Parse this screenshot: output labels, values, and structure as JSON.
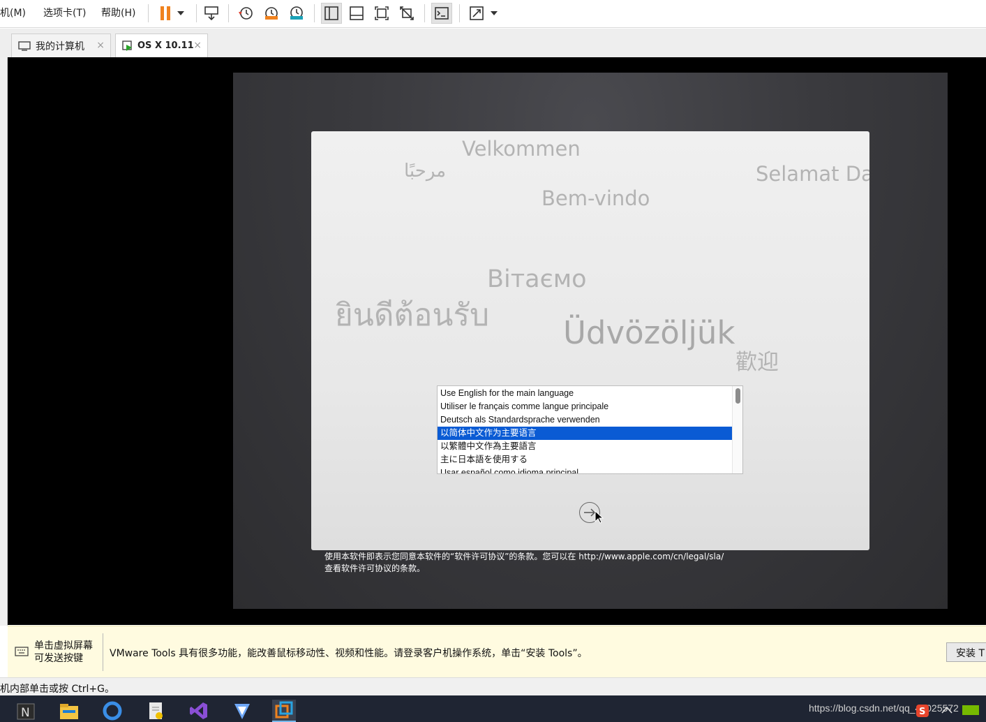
{
  "menu": {
    "items": [
      "机(M)",
      "选项卡(T)",
      "帮助(H)"
    ]
  },
  "tabs": [
    {
      "label": "我的计算机"
    },
    {
      "label": "OS X 10.11"
    }
  ],
  "tab_close_glyph": "×",
  "setup": {
    "greetings": {
      "velkommen": "Velkommen",
      "marhaban": "مرحبًا",
      "selamat": "Selamat Da",
      "bemvindo": "Bem-vindo",
      "vitaemo": "Вітаємо",
      "thai": "ยินดีต้อนรับ",
      "udvozoljuk": "Üdvözöljük",
      "huanying": "歡迎"
    },
    "languages": [
      "Use English for the main language",
      "Utiliser le français comme langue principale",
      "Deutsch als Standardsprache verwenden",
      "以简体中文作为主要语言",
      "以繁體中文作為主要語言",
      "主に日本語を使用する",
      "Usar español como idioma principal"
    ],
    "selected_language": "以简体中文作为主要语言",
    "license_line1": "使用本软件即表示您同意本软件的“软件许可协议”的条款。您可以在 http://www.apple.com/cn/legal/sla/",
    "license_line2": "查看软件许可协议的条款。"
  },
  "infobar": {
    "left_line1": "单击虚拟屏幕",
    "left_line2": "可发送按键",
    "message": "VMware Tools 具有很多功能，能改善鼠标移动性、视频和性能。请登录客户机操作系统，单击“安装 Tools”。",
    "install_button": "安装 T"
  },
  "statusbar": {
    "text": "机内部单击或按 Ctrl+G。"
  },
  "taskbar": {
    "watermark": "https://blog.csdn.net/qq_45025572"
  },
  "colors": {
    "selection": "#0a5bd4",
    "pause_orange": "#f0821e",
    "infobar_bg": "#fffbe0",
    "taskbar_bg": "#1f2533"
  }
}
